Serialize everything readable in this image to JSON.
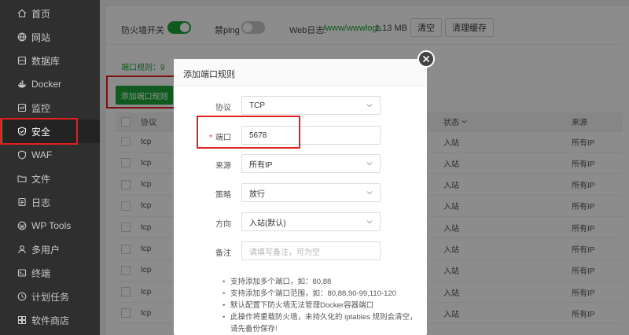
{
  "sidebar": {
    "items": [
      {
        "label": "首页",
        "icon": "home-icon"
      },
      {
        "label": "网站",
        "icon": "globe-icon"
      },
      {
        "label": "数据库",
        "icon": "database-icon"
      },
      {
        "label": "Docker",
        "icon": "docker-icon"
      },
      {
        "label": "监控",
        "icon": "monitor-icon"
      },
      {
        "label": "安全",
        "icon": "shield-icon",
        "active": true
      },
      {
        "label": "WAF",
        "icon": "waf-icon"
      },
      {
        "label": "文件",
        "icon": "folder-icon"
      },
      {
        "label": "日志",
        "icon": "log-icon"
      },
      {
        "label": "WP Tools",
        "icon": "wordpress-icon"
      },
      {
        "label": "多用户",
        "icon": "users-icon"
      },
      {
        "label": "终端",
        "icon": "terminal-icon"
      },
      {
        "label": "计划任务",
        "icon": "clock-icon"
      },
      {
        "label": "软件商店",
        "icon": "store-icon"
      }
    ]
  },
  "toolbar": {
    "firewall_label": "防火墙开关",
    "firewall_on": true,
    "ping_label": "禁ping",
    "ping_on": false,
    "weblog_label": "Web日志:",
    "weblog_path": "/www/wwwlogs",
    "weblog_size": "1.13 MB",
    "clear_label": "清空",
    "clear_cache_label": "清理缓存"
  },
  "tabs": {
    "port_rules_label": "端口规则：9"
  },
  "add_button_label": "添加端口规则",
  "table": {
    "headers": {
      "protocol": "协议",
      "status": "状态",
      "source": "来源"
    },
    "rows": [
      {
        "protocol": "tcp",
        "status": "入站",
        "source": "所有IP"
      },
      {
        "protocol": "tcp",
        "status": "入站",
        "source": "所有IP"
      },
      {
        "protocol": "tcp",
        "status": "入站",
        "source": "所有IP"
      },
      {
        "protocol": "tcp",
        "status": "入站",
        "source": "所有IP"
      },
      {
        "protocol": "tcp",
        "status": "入站",
        "source": "所有IP"
      },
      {
        "protocol": "tcp",
        "status": "入站",
        "source": "所有IP"
      },
      {
        "protocol": "tcp",
        "status": "入站",
        "source": "所有IP"
      },
      {
        "protocol": "tcp",
        "status": "入站",
        "source": "所有IP"
      },
      {
        "protocol": "tcp",
        "status": "入站",
        "source": "所有IP"
      }
    ]
  },
  "modal": {
    "title": "添加端口规则",
    "protocol_label": "协议",
    "protocol_value": "TCP",
    "port_required_mark": "*",
    "port_label": "端口",
    "port_value": "5678",
    "source_label": "来源",
    "source_value": "所有IP",
    "strategy_label": "策略",
    "strategy_value": "放行",
    "direction_label": "方向",
    "direction_value": "入站(默认)",
    "remark_label": "备注",
    "remark_placeholder": "请填写备注，可为空",
    "tips": [
      "支持添加多个端口，如：80,88",
      "支持添加多个端口范围，如：80,88,90-99,110-120",
      "默认配置下防火墙无法管理Docker容器端口",
      "此操作将重载防火墙，未持久化的 iptables 规则会清空，请先备份保存!"
    ]
  },
  "colors": {
    "accent": "#20a53a",
    "sidebar_bg": "#2f2f2f",
    "highlight": "#e02020"
  }
}
